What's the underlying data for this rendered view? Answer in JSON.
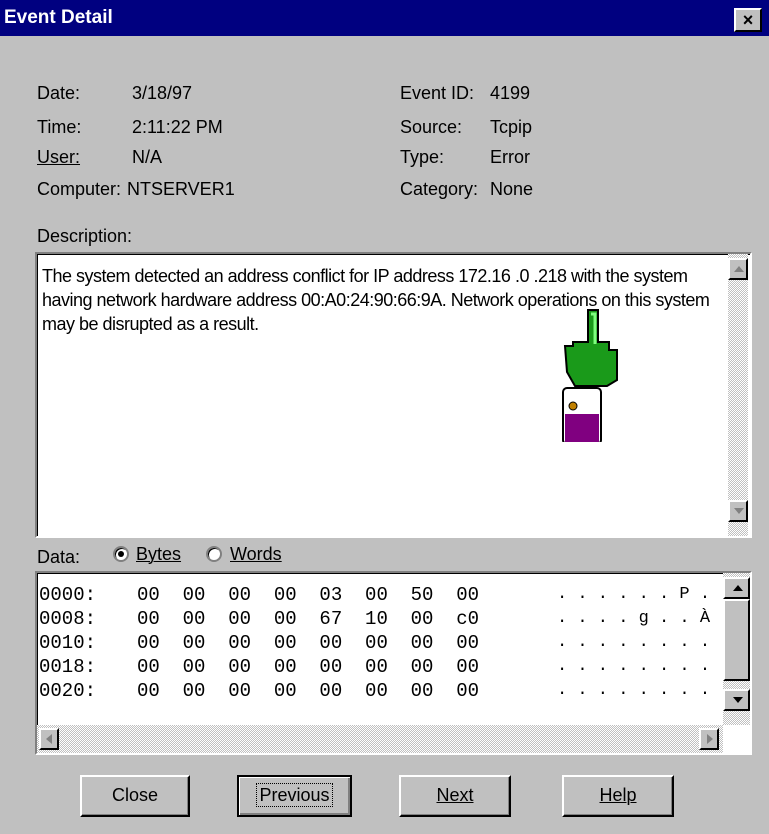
{
  "window": {
    "title": "Event Detail",
    "close_glyph": "×"
  },
  "fields": {
    "date_label": "Date:",
    "date_value": "3/18/97",
    "time_label": "Time:",
    "time_value": "2:11:22 PM",
    "user_label": "User:",
    "user_value": "N/A",
    "computer_label": "Computer:",
    "computer_value": "NTSERVER1",
    "event_id_label": "Event ID:",
    "event_id_value": "4199",
    "source_label": "Source:",
    "source_value": "Tcpip",
    "type_label": "Type:",
    "type_value": "Error",
    "category_label": "Category:",
    "category_value": "None"
  },
  "description": {
    "label": "Description:",
    "text": "The system detected an address conflict for IP address 172.16 .0 .218 with the system having network hardware address 00:A0:24:90:66:9A. Network operations on this system may be disrupted as a result."
  },
  "data_section": {
    "label": "Data:",
    "format_options": [
      "Bytes",
      "Words"
    ],
    "selected_format": "Bytes",
    "rows": [
      {
        "offset": "0000:",
        "hex": "00  00  00  00  03  00  50  00",
        "ascii": ". . . . . . P ."
      },
      {
        "offset": "0008:",
        "hex": "00  00  00  00  67  10  00  c0",
        "ascii": ". . . . g . . À"
      },
      {
        "offset": "0010:",
        "hex": "00  00  00  00  00  00  00  00",
        "ascii": ". . . . . . . ."
      },
      {
        "offset": "0018:",
        "hex": "00  00  00  00  00  00  00  00",
        "ascii": ". . . . . . . ."
      },
      {
        "offset": "0020:",
        "hex": "00  00  00  00  00  00  00  00",
        "ascii": ". . . . . . . ."
      }
    ]
  },
  "buttons": {
    "close": "Close",
    "previous": "Previous",
    "next": "Next",
    "help": "Help"
  },
  "icons": {
    "cursor": "hand-pointer-icon",
    "overlay": "bottle-icon"
  },
  "colors": {
    "titlebar": "#000080",
    "dialog": "#c0c0c0",
    "hand": "#1a9a1a",
    "bottle": "#800080"
  }
}
